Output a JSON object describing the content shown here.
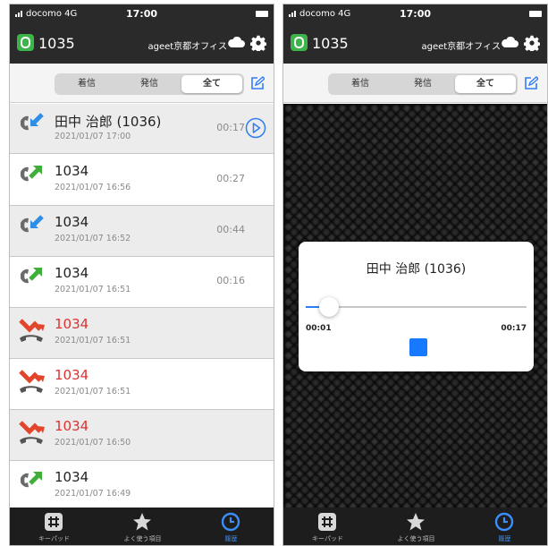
{
  "status_bar": {
    "carrier": "docomo 4G",
    "time": "17:00"
  },
  "header": {
    "extension": "1035",
    "office": "ageet京都オフィス"
  },
  "segments": [
    {
      "label": "着信",
      "active": false
    },
    {
      "label": "発信",
      "active": false
    },
    {
      "label": "全て",
      "active": true
    }
  ],
  "calls": [
    {
      "name": "田中 治郎 (1036)",
      "date": "2021/01/07 17:00",
      "duration": "00:17",
      "direction": "incoming",
      "highlight": true,
      "has_recording": true
    },
    {
      "name": "1034",
      "date": "2021/01/07 16:56",
      "duration": "00:27",
      "direction": "outgoing",
      "highlight": false
    },
    {
      "name": "1034",
      "date": "2021/01/07 16:52",
      "duration": "00:44",
      "direction": "incoming",
      "highlight": true
    },
    {
      "name": "1034",
      "date": "2021/01/07 16:51",
      "duration": "00:16",
      "direction": "outgoing",
      "highlight": false
    },
    {
      "name": "1034",
      "date": "2021/01/07 16:51",
      "duration": "",
      "direction": "missed",
      "highlight": true
    },
    {
      "name": "1034",
      "date": "2021/01/07 16:51",
      "duration": "",
      "direction": "missed",
      "highlight": false
    },
    {
      "name": "1034",
      "date": "2021/01/07 16:50",
      "duration": "",
      "direction": "missed",
      "highlight": true
    },
    {
      "name": "1034",
      "date": "2021/01/07 16:49",
      "duration": "",
      "direction": "outgoing",
      "highlight": false
    }
  ],
  "tabs": [
    {
      "label": "キーパッド",
      "icon": "keypad-icon",
      "active": false
    },
    {
      "label": "よく使う項目",
      "icon": "star-icon",
      "active": false
    },
    {
      "label": "履歴",
      "icon": "history-clock-icon",
      "active": true
    }
  ],
  "player": {
    "title": "田中 治郎 (1036)",
    "current_time": "00:01",
    "total_time": "00:17",
    "progress": 0.06
  },
  "colors": {
    "accent": "#2f7cf6",
    "missed": "#e03030",
    "bar_bg": "#2a2a2a",
    "badge": "#3cb44a"
  }
}
